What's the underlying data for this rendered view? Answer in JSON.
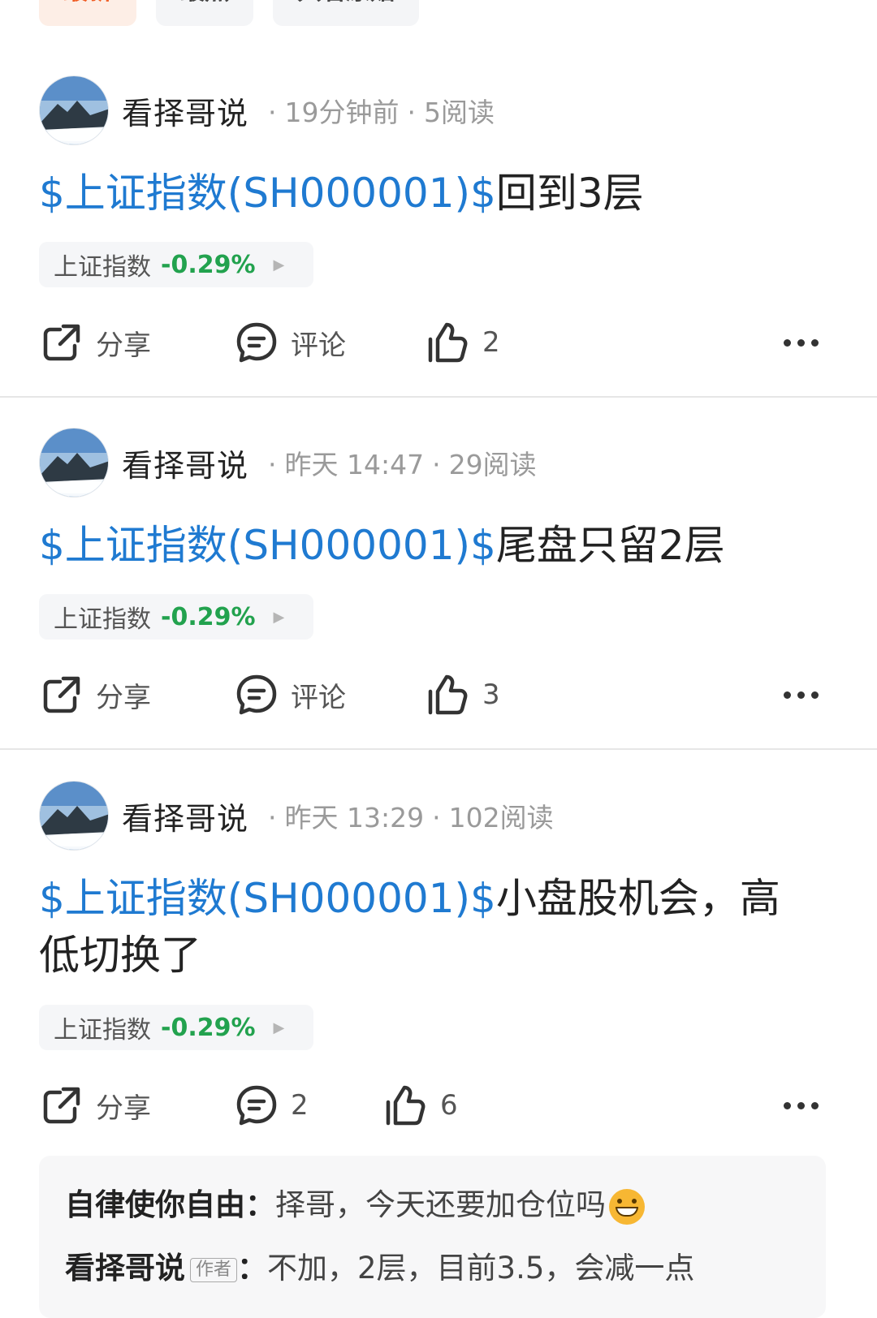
{
  "tabs": [
    {
      "label": "最新",
      "active": true
    },
    {
      "label": "最热",
      "active": false
    },
    {
      "label": "只看原贴",
      "active": false
    }
  ],
  "posts": [
    {
      "author": "看择哥说",
      "time": "19分钟前",
      "reads": "5阅读",
      "tag": "$上证指数(SH000001)$",
      "text": "回到3层",
      "chip_name": "上证指数",
      "chip_pct": "-0.29%",
      "share_label": "分享",
      "comment_label": "评论",
      "likes": "2"
    },
    {
      "author": "看择哥说",
      "time": "昨天 14:47",
      "reads": "29阅读",
      "tag": "$上证指数(SH000001)$",
      "text": "尾盘只留2层",
      "chip_name": "上证指数",
      "chip_pct": "-0.29%",
      "share_label": "分享",
      "comment_label": "评论",
      "likes": "3"
    },
    {
      "author": "看择哥说",
      "time": "昨天 13:29",
      "reads": "102阅读",
      "tag": "$上证指数(SH000001)$",
      "text": "小盘股机会，高低切换了",
      "chip_name": "上证指数",
      "chip_pct": "-0.29%",
      "share_label": "分享",
      "comment_label": "2",
      "likes": "6"
    }
  ],
  "comments": [
    {
      "who": "自律使你自由",
      "sep": "：",
      "text": "择哥，今天还要加仓位吗"
    },
    {
      "who": "看择哥说",
      "badge": "作者",
      "sep": "：",
      "text": "不加，2层，目前3.5，会减一点"
    }
  ],
  "colors": {
    "accent": "#f05b22",
    "link": "#1f7ad1",
    "down": "#22a24e"
  },
  "icons": [
    "share-icon",
    "comment-icon",
    "thumbs-up-icon",
    "more-icon",
    "grin-emoji-icon"
  ]
}
